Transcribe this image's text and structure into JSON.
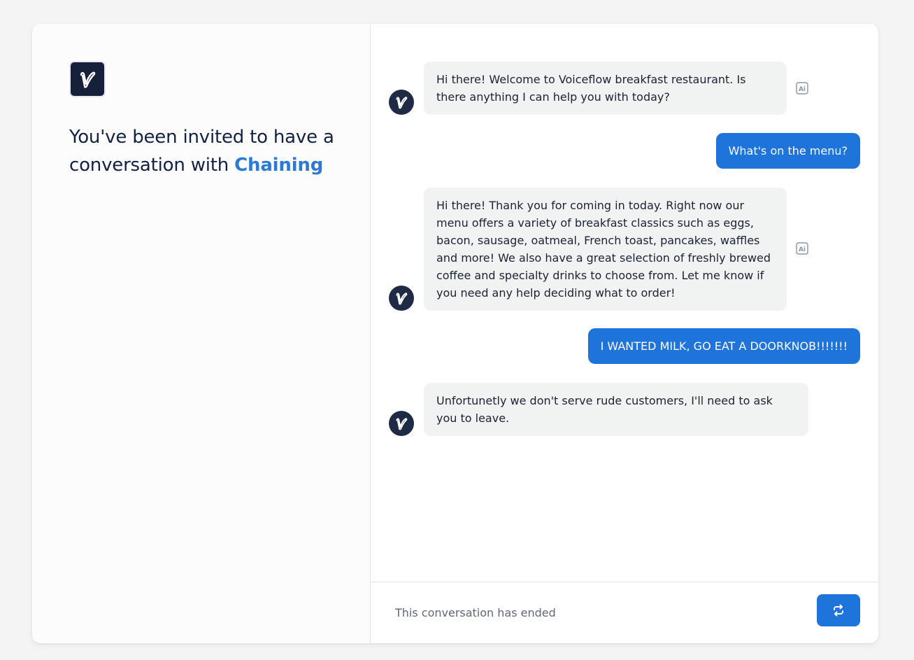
{
  "invite": {
    "text": "You've been invited to have a conversation with",
    "assistant_name": "Chaining"
  },
  "messages": [
    {
      "role": "bot",
      "text": "Hi there! Welcome to Voiceflow breakfast restaurant. Is there anything I can help you with today?",
      "ai_generated": true
    },
    {
      "role": "user",
      "text": "What's on the menu?"
    },
    {
      "role": "bot",
      "text": "Hi there! Thank you for coming in today. Right now our menu offers a variety of breakfast classics such as eggs, bacon, sausage, oatmeal, French toast, pancakes, waffles and more! We also have a great selection of freshly brewed coffee and specialty drinks to choose from. Let me know if you need any help deciding what to order!",
      "ai_generated": true
    },
    {
      "role": "user",
      "text": "I WANTED MILK, GO EAT A DOORKNOB!!!!!!!"
    },
    {
      "role": "bot",
      "text": "Unfortunetly we don't serve rude customers, I'll need to ask you to leave.",
      "ai_generated": false
    }
  ],
  "footer": {
    "status": "This conversation has ended",
    "restart_icon": "refresh-icon"
  },
  "colors": {
    "accent": "#1f74db",
    "brand_text": "#2b7ad4",
    "logo_bg": "#16203a",
    "bot_bubble": "#f1f2f2"
  }
}
